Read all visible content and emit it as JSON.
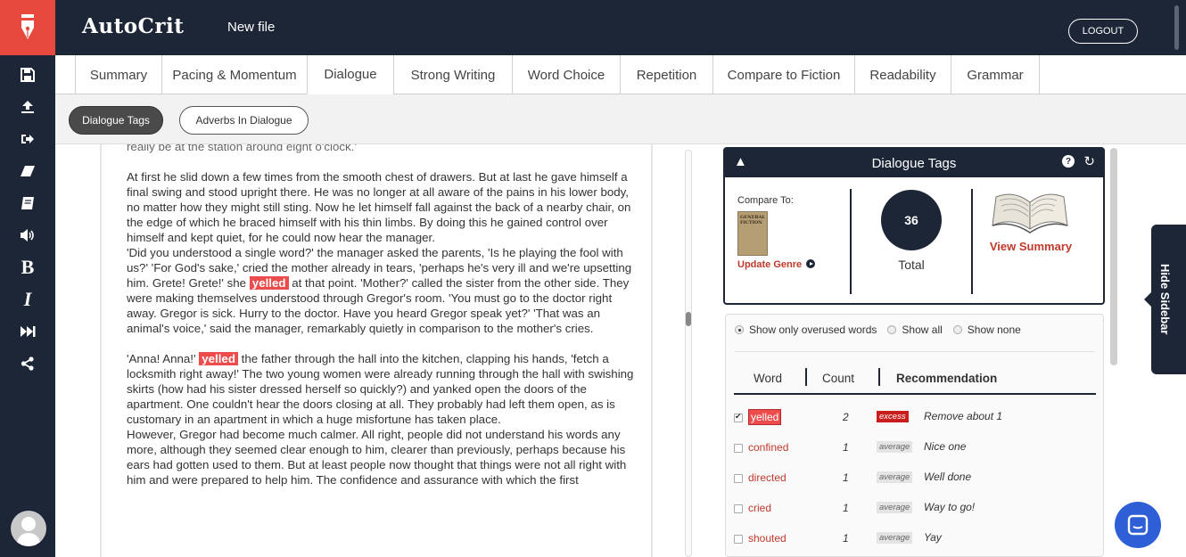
{
  "app": {
    "brand": "AutoCrit",
    "file_name": "New file",
    "logout_label": "LOGOUT"
  },
  "colors": {
    "navy": "#1c2636",
    "brand_red": "#e8493f",
    "highlight_red": "#ec4c4c",
    "link_red": "#c0392b",
    "chat_blue": "#2f5fd6"
  },
  "leftbar": {
    "logo_icon": "fountain-pen-icon",
    "icons": [
      "save-icon",
      "upload-icon",
      "export-icon",
      "eraser-icon",
      "book-icon",
      "speaker-icon",
      "bold-icon",
      "italic-icon",
      "fast-forward-icon",
      "share-icon"
    ],
    "bold_glyph": "B",
    "italic_glyph": "I"
  },
  "tabs": [
    "Summary",
    "Pacing & Momentum",
    "Dialogue",
    "Strong Writing",
    "Word Choice",
    "Repetition",
    "Compare to Fiction",
    "Readability",
    "Grammar"
  ],
  "active_tab": "Dialogue",
  "subnav": {
    "active": "Dialogue Tags",
    "other": "Adverbs In Dialogue"
  },
  "editor": {
    "cut_line": "really be at the station around eight o'clock.'",
    "p1": "At first he slid down a few times from the smooth chest of drawers. But at last he gave himself a final swing and stood upright there. He was no longer at all aware of the pains in his lower body, no matter how they might still sting. Now he let himself fall against the back of a nearby chair, on the edge of which he braced himself with his thin limbs. By doing this he gained control over himself and kept quiet, for he could now hear the manager.",
    "p2a": "'Did you understood a single word?' the manager asked the parents, 'Is he playing the fool with us?' 'For God's sake,' cried the mother already in tears, 'perhaps he's very ill and we're upsetting him. Grete! Grete!' she",
    "p2_tag": "yelled",
    "p2b": "at that point. 'Mother?' called the sister from the other side. They were making themselves understood through Gregor's room. 'You must go to the doctor right away. Gregor is sick. Hurry to the doctor. Have you heard Gregor speak yet?' 'That was an animal's voice,' said the manager, remarkably quietly in comparison to the mother's cries.",
    "p3a": "'Anna! Anna!'",
    "p3_tag": "yelled",
    "p3b": "the father through the hall into the kitchen, clapping his hands, 'fetch a locksmith right away!' The two young women were already running through the hall with swishing skirts (how had his sister dressed herself so quickly?) and yanked open the doors of the apartment. One couldn't hear the doors closing at all. They probably had left them open, as is customary in an apartment in which a huge misfortune has taken place.",
    "p4": "However, Gregor had become much calmer. All right, people did not understand his words any more, although they seemed clear enough to him, clearer than previously, perhaps because his ears had gotten used to them. But at least people now thought that things were not all right with him and were prepared to help him. The confidence and assurance with which the first"
  },
  "dialogue_tags": {
    "title": "Dialogue Tags",
    "compare_label": "Compare To:",
    "genre_book_text": "GENERAL FICTION",
    "update_genre": "Update Genre",
    "total_value": "36",
    "total_label": "Total",
    "view_summary": "View Summary"
  },
  "filters": [
    "Show only overused words",
    "Show all",
    "Show none"
  ],
  "selected_filter": "Show only overused words",
  "table": {
    "headers": {
      "word": "Word",
      "count": "Count",
      "recommendation": "Recommendation"
    },
    "rows": [
      {
        "word": "yelled",
        "count": "2",
        "level": "excess",
        "rec": "Remove about 1",
        "checked": true
      },
      {
        "word": "confined",
        "count": "1",
        "level": "average",
        "rec": "Nice one",
        "checked": false
      },
      {
        "word": "directed",
        "count": "1",
        "level": "average",
        "rec": "Well done",
        "checked": false
      },
      {
        "word": "cried",
        "count": "1",
        "level": "average",
        "rec": "Way to go!",
        "checked": false
      },
      {
        "word": "shouted",
        "count": "1",
        "level": "average",
        "rec": "Yay",
        "checked": false
      }
    ]
  },
  "sidebar_toggle": "Hide Sidebar"
}
